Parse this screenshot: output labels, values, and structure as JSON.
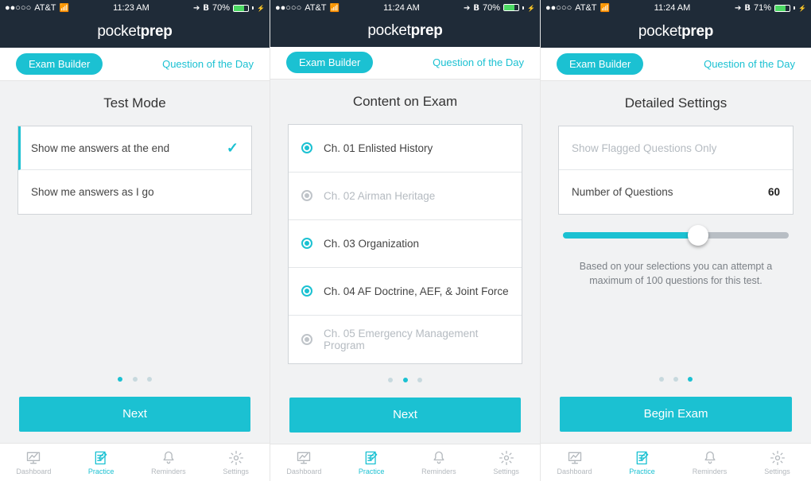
{
  "screens": [
    {
      "status": {
        "carrier": "AT&T",
        "signal": "●●○○○",
        "time": "11:23 AM",
        "battery": "70%"
      },
      "logo": {
        "a": "pocket",
        "b": "prep"
      },
      "subnav": {
        "pill": "Exam Builder",
        "qotd": "Question of the Day"
      },
      "title": "Test Mode",
      "options": [
        {
          "label": "Show me answers at the end",
          "selected": true
        },
        {
          "label": "Show me answers as I go",
          "selected": false
        }
      ],
      "cta": "Next",
      "active_dot": 0
    },
    {
      "status": {
        "carrier": "AT&T",
        "signal": "●●○○○",
        "time": "11:24 AM",
        "battery": "70%"
      },
      "logo": {
        "a": "pocket",
        "b": "prep"
      },
      "subnav": {
        "pill": "Exam Builder",
        "qotd": "Question of the Day"
      },
      "title": "Content on Exam",
      "chapters": [
        {
          "label": "Ch. 01 Enlisted History",
          "state": "on"
        },
        {
          "label": "Ch. 02 Airman Heritage",
          "state": "off"
        },
        {
          "label": "Ch. 03 Organization",
          "state": "on"
        },
        {
          "label": "Ch. 04 AF Doctrine, AEF, & Joint Force",
          "state": "on"
        },
        {
          "label": "Ch. 05 Emergency Management Program",
          "state": "off"
        }
      ],
      "cta": "Next",
      "active_dot": 1
    },
    {
      "status": {
        "carrier": "AT&T",
        "signal": "●●○○○",
        "time": "11:24 AM",
        "battery": "71%"
      },
      "logo": {
        "a": "pocket",
        "b": "prep"
      },
      "subnav": {
        "pill": "Exam Builder",
        "qotd": "Question of the Day"
      },
      "title": "Detailed Settings",
      "settings": {
        "flagged_label": "Show Flagged Questions Only",
        "num_label": "Number of Questions",
        "num_value": "60",
        "note_a": "Based on your selections you can attempt a",
        "note_b": "maximum of 100 questions for this test."
      },
      "cta": "Begin Exam",
      "active_dot": 2
    }
  ],
  "tabs": [
    {
      "label": "Dashboard"
    },
    {
      "label": "Practice"
    },
    {
      "label": "Reminders"
    },
    {
      "label": "Settings"
    }
  ]
}
